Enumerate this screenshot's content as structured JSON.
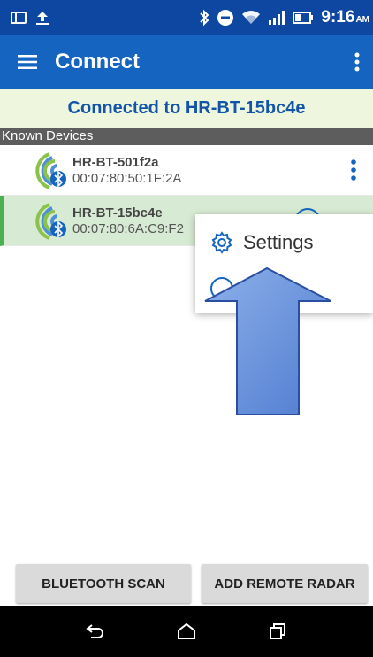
{
  "status_bar": {
    "time": "9:16",
    "time_suffix": "AM",
    "icons": [
      "screen-cast-icon",
      "upload-icon",
      "bluetooth-icon",
      "do-not-disturb-icon",
      "wifi-icon",
      "signal-icon",
      "battery-icon"
    ]
  },
  "app_bar": {
    "title": "Connect",
    "menu_icon": "hamburger-menu-icon",
    "overflow_icon": "more-vert-icon"
  },
  "banner": {
    "text": "Connected to HR-BT-15bc4e"
  },
  "known_devices": {
    "header": "Known Devices",
    "items": [
      {
        "name": "HR-BT-501f2a",
        "address": "00:07:80:50:1F:2A",
        "selected": false
      },
      {
        "name": "HR-BT-15bc4e",
        "address": "00:07:80:6A:C9:F2",
        "selected": true
      }
    ]
  },
  "popup_menu": {
    "items": [
      {
        "label": "Settings",
        "icon": "gear-icon"
      }
    ]
  },
  "buttons": {
    "scan": "BLUETOOTH SCAN",
    "remote": "ADD REMOTE RADAR"
  },
  "colors": {
    "status_bar": "#0d47a1",
    "app_bar": "#1565c0",
    "banner_bg": "#eef7dd",
    "banner_text": "#1255a8",
    "selected_row": "#d7ead3",
    "selected_accent": "#4caf50",
    "arrow_fill": "#6f96e0"
  }
}
